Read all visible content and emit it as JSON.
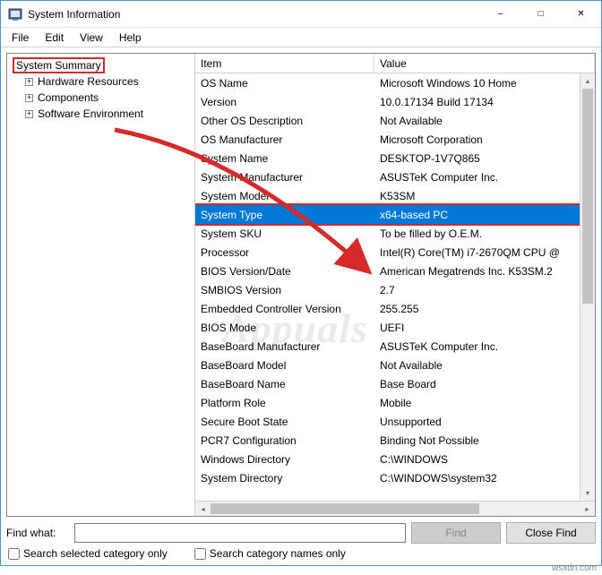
{
  "title": "System Information",
  "menubar": [
    "File",
    "Edit",
    "View",
    "Help"
  ],
  "tree": {
    "root": "System Summary",
    "children": [
      "Hardware Resources",
      "Components",
      "Software Environment"
    ]
  },
  "columns": {
    "item": "Item",
    "value": "Value"
  },
  "rows": [
    {
      "item": "OS Name",
      "value": "Microsoft Windows 10 Home"
    },
    {
      "item": "Version",
      "value": "10.0.17134 Build 17134"
    },
    {
      "item": "Other OS Description",
      "value": "Not Available"
    },
    {
      "item": "OS Manufacturer",
      "value": "Microsoft Corporation"
    },
    {
      "item": "System Name",
      "value": "DESKTOP-1V7Q865"
    },
    {
      "item": "System Manufacturer",
      "value": "ASUSTeK Computer Inc."
    },
    {
      "item": "System Model",
      "value": "K53SM"
    },
    {
      "item": "System Type",
      "value": "x64-based PC",
      "selected": true
    },
    {
      "item": "System SKU",
      "value": "To be filled by O.E.M."
    },
    {
      "item": "Processor",
      "value": "Intel(R) Core(TM) i7-2670QM CPU @"
    },
    {
      "item": "BIOS Version/Date",
      "value": "American Megatrends Inc. K53SM.2"
    },
    {
      "item": "SMBIOS Version",
      "value": "2.7"
    },
    {
      "item": "Embedded Controller Version",
      "value": "255.255"
    },
    {
      "item": "BIOS Mode",
      "value": "UEFI"
    },
    {
      "item": "BaseBoard Manufacturer",
      "value": "ASUSTeK Computer Inc."
    },
    {
      "item": "BaseBoard Model",
      "value": "Not Available"
    },
    {
      "item": "BaseBoard Name",
      "value": "Base Board"
    },
    {
      "item": "Platform Role",
      "value": "Mobile"
    },
    {
      "item": "Secure Boot State",
      "value": "Unsupported"
    },
    {
      "item": "PCR7 Configuration",
      "value": "Binding Not Possible"
    },
    {
      "item": "Windows Directory",
      "value": "C:\\WINDOWS"
    },
    {
      "item": "System Directory",
      "value": "C:\\WINDOWS\\system32"
    }
  ],
  "find": {
    "label": "Find what:",
    "value": "",
    "find_btn": "Find",
    "close_btn": "Close Find",
    "chk1": "Search selected category only",
    "chk2": "Search category names only"
  },
  "watermark": "Appuals",
  "site": "wsxdn.com"
}
